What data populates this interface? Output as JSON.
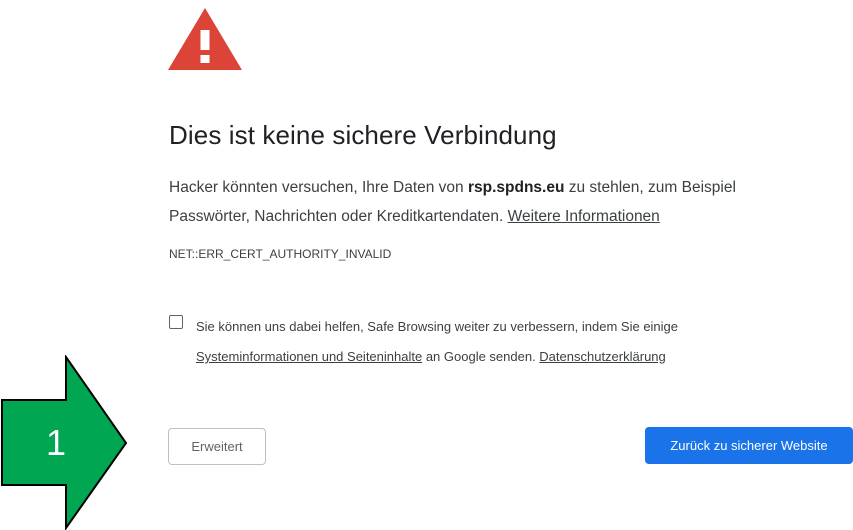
{
  "icon": {
    "name": "warning-icon",
    "color": "#db4437",
    "glyph": "!"
  },
  "title": "Dies ist keine sichere Verbindung",
  "description": {
    "part1": "Hacker könnten versuchen, Ihre Daten von ",
    "domain": "rsp.spdns.eu",
    "part2": " zu stehlen, zum Beispiel Passwörter, Nachrichten oder Kreditkartendaten. ",
    "more_info_link": "Weitere Informationen"
  },
  "error_code": "NET::ERR_CERT_AUTHORITY_INVALID",
  "safe_browsing": {
    "checked": false,
    "part1": "Sie können uns dabei helfen, Safe Browsing weiter zu verbessern, indem Sie einige ",
    "system_info_link": "Systeminformationen und Seiteninhalte",
    "part2": " an Google senden. ",
    "privacy_link": "Datenschutzerklärung"
  },
  "buttons": {
    "advanced_label": "Erweitert",
    "back_label": "Zurück zu sicherer Website"
  },
  "annotation": {
    "number": "1",
    "color": "#00a651",
    "icon": "arrow-right-icon"
  },
  "colors": {
    "primary_button": "#1a73e8",
    "text": "#202124",
    "secondary_text": "#3c4043"
  }
}
